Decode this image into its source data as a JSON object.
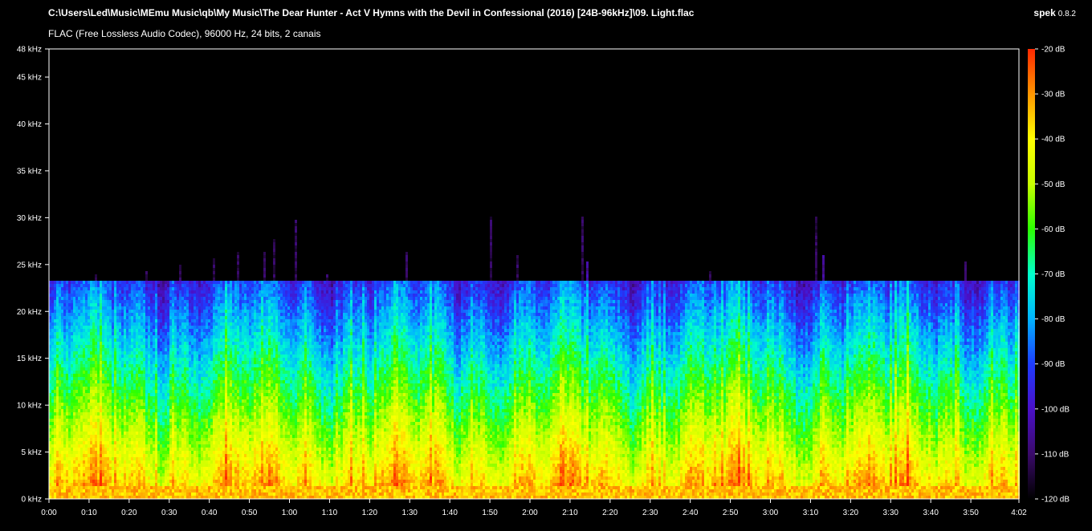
{
  "header": {
    "file_path": "C:\\Users\\Led\\Music\\MEmu Music\\qb\\My Music\\The Dear Hunter - Act V Hymns with the Devil in Confessional (2016) [24B-96kHz]\\09. Light.flac",
    "file_info": "FLAC (Free Lossless Audio Codec), 96000 Hz, 24 bits, 2 canais",
    "app_name": "spek",
    "app_version": "0.8.2"
  },
  "chart_data": {
    "type": "heatmap",
    "title": "",
    "xlabel": "",
    "ylabel": "",
    "x_unit": "time (m:ss)",
    "y_unit": "kHz",
    "duration_seconds": 242,
    "ylim_khz": [
      0,
      48
    ],
    "x_tick_labels": [
      "0:00",
      "0:10",
      "0:20",
      "0:30",
      "0:40",
      "0:50",
      "1:00",
      "1:10",
      "1:20",
      "1:30",
      "1:40",
      "1:50",
      "2:00",
      "2:10",
      "2:20",
      "2:30",
      "2:40",
      "2:50",
      "3:00",
      "3:10",
      "3:20",
      "3:30",
      "3:40",
      "3:50",
      "4:02"
    ],
    "x_tick_seconds": [
      0,
      10,
      20,
      30,
      40,
      50,
      60,
      70,
      80,
      90,
      100,
      110,
      120,
      130,
      140,
      150,
      160,
      170,
      180,
      190,
      200,
      210,
      220,
      230,
      242
    ],
    "y_ticks": [
      {
        "khz": 0,
        "label": "0 kHz"
      },
      {
        "khz": 5,
        "label": "5 kHz"
      },
      {
        "khz": 10,
        "label": "10 kHz"
      },
      {
        "khz": 15,
        "label": "15 kHz"
      },
      {
        "khz": 20,
        "label": "20 kHz"
      },
      {
        "khz": 25,
        "label": "25 kHz"
      },
      {
        "khz": 30,
        "label": "30 kHz"
      },
      {
        "khz": 35,
        "label": "35 kHz"
      },
      {
        "khz": 40,
        "label": "40 kHz"
      },
      {
        "khz": 45,
        "label": "45 kHz"
      },
      {
        "khz": 48,
        "label": "48 kHz"
      }
    ],
    "colorbar": {
      "range_db": [
        -120,
        -20
      ],
      "ticks": [
        {
          "db": -20,
          "label": "-20 dB"
        },
        {
          "db": -30,
          "label": "-30 dB"
        },
        {
          "db": -40,
          "label": "-40 dB"
        },
        {
          "db": -50,
          "label": "-50 dB"
        },
        {
          "db": -60,
          "label": "-60 dB"
        },
        {
          "db": -70,
          "label": "-70 dB"
        },
        {
          "db": -80,
          "label": "-80 dB"
        },
        {
          "db": -90,
          "label": "-90 dB"
        },
        {
          "db": -100,
          "label": "-100 dB"
        },
        {
          "db": -110,
          "label": "-110 dB"
        },
        {
          "db": -120,
          "label": "-120 dB"
        }
      ],
      "colors": [
        "#000000",
        "#3a0a6a",
        "#4a10c8",
        "#1e3cff",
        "#00b4ff",
        "#00ffcc",
        "#2cff00",
        "#c8ff00",
        "#ffff00",
        "#ff9600",
        "#ff2800"
      ]
    },
    "content_cutoff_khz": 23,
    "occasional_peaks_khz": 31
  }
}
